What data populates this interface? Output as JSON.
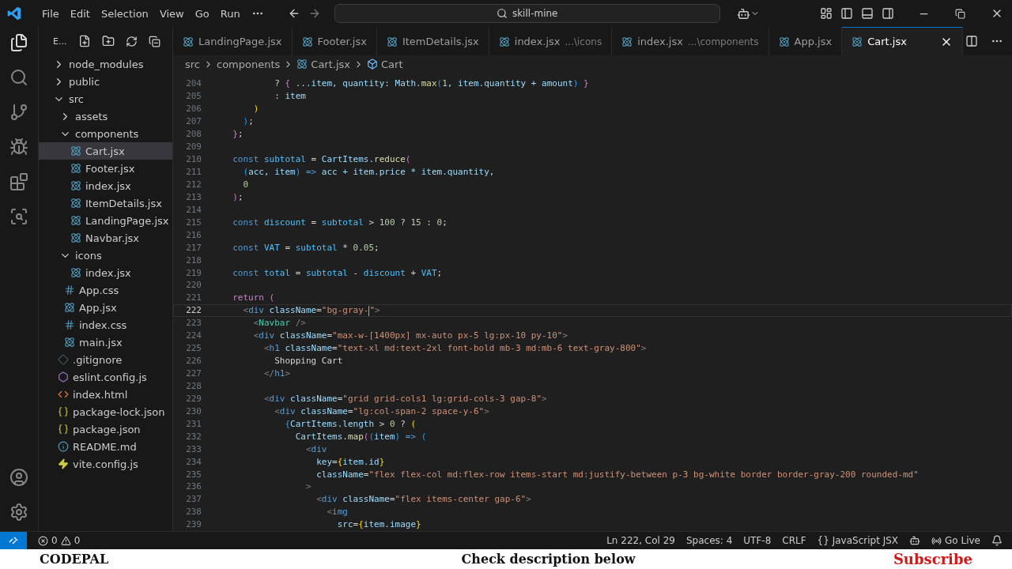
{
  "menu": [
    "File",
    "Edit",
    "Selection",
    "View",
    "Go",
    "Run"
  ],
  "search": {
    "value": "skill-mine"
  },
  "explorer": {
    "title": "E..."
  },
  "tree": [
    {
      "label": "node_modules",
      "kind": "folder",
      "expanded": false,
      "selected": false
    },
    {
      "label": "public",
      "kind": "folder",
      "expanded": false,
      "selected": false
    },
    {
      "label": "src",
      "kind": "folder",
      "expanded": true,
      "selected": false,
      "children": [
        {
          "label": "assets",
          "kind": "folder",
          "expanded": false,
          "selected": false
        },
        {
          "label": "components",
          "kind": "folder",
          "expanded": true,
          "selected": false,
          "children": [
            {
              "label": "Cart.jsx",
              "kind": "react",
              "selected": true
            },
            {
              "label": "Footer.jsx",
              "kind": "react",
              "selected": false
            },
            {
              "label": "index.jsx",
              "kind": "react",
              "selected": false
            },
            {
              "label": "ItemDetails.jsx",
              "kind": "react",
              "selected": false
            },
            {
              "label": "LandingPage.jsx",
              "kind": "react",
              "selected": false
            },
            {
              "label": "Navbar.jsx",
              "kind": "react",
              "selected": false
            }
          ]
        },
        {
          "label": "icons",
          "kind": "folder",
          "expanded": true,
          "selected": false,
          "children": [
            {
              "label": "index.jsx",
              "kind": "react",
              "selected": false
            }
          ]
        },
        {
          "label": "App.css",
          "kind": "css",
          "selected": false
        },
        {
          "label": "App.jsx",
          "kind": "react",
          "selected": false
        },
        {
          "label": "index.css",
          "kind": "css",
          "selected": false
        },
        {
          "label": "main.jsx",
          "kind": "react",
          "selected": false
        }
      ]
    },
    {
      "label": ".gitignore",
      "kind": "git",
      "selected": false
    },
    {
      "label": "eslint.config.js",
      "kind": "eslint",
      "selected": false
    },
    {
      "label": "index.html",
      "kind": "html",
      "selected": false
    },
    {
      "label": "package-lock.json",
      "kind": "json",
      "selected": false
    },
    {
      "label": "package.json",
      "kind": "json",
      "selected": false
    },
    {
      "label": "README.md",
      "kind": "info",
      "selected": false
    },
    {
      "label": "vite.config.js",
      "kind": "vite",
      "selected": false
    }
  ],
  "tabs": [
    {
      "label": "LandingPage.jsx",
      "selected": false
    },
    {
      "label": "Footer.jsx",
      "selected": false
    },
    {
      "label": "ItemDetails.jsx",
      "selected": false
    },
    {
      "label": "index.jsx",
      "description": "...\\icons",
      "selected": false
    },
    {
      "label": "index.jsx",
      "description": "...\\components",
      "selected": false
    },
    {
      "label": "App.jsx",
      "selected": false
    },
    {
      "label": "Cart.jsx",
      "selected": true
    }
  ],
  "breadcrumb": [
    {
      "label": "src",
      "kind": "folder"
    },
    {
      "label": "components",
      "kind": "folder"
    },
    {
      "label": "Cart.jsx",
      "kind": "react"
    },
    {
      "label": "Cart",
      "kind": "symbol"
    }
  ],
  "lines": [
    {
      "number": "204",
      "current": false,
      "tokens": [
        {
          "text": "          ? ",
          "kind": "op"
        },
        {
          "text": "{",
          "kind": "p2"
        },
        {
          "text": " ...item, quantity: ",
          "kind": "var"
        },
        {
          "text": "Math",
          "kind": "var"
        },
        {
          "text": ".",
          "kind": "op"
        },
        {
          "text": "max",
          "kind": "fn"
        },
        {
          "text": "(",
          "kind": "p3"
        },
        {
          "text": "1",
          "kind": "num"
        },
        {
          "text": ", item.quantity + amount",
          "kind": "var"
        },
        {
          "text": ")",
          "kind": "p3"
        },
        {
          "text": " }",
          "kind": "p2"
        }
      ]
    },
    {
      "number": "205",
      "current": false,
      "tokens": [
        {
          "text": "          : ",
          "kind": "op"
        },
        {
          "text": "item",
          "kind": "var"
        }
      ]
    },
    {
      "number": "206",
      "current": false,
      "tokens": [
        {
          "text": "      )",
          "kind": "p1"
        }
      ]
    },
    {
      "number": "207",
      "current": false,
      "tokens": [
        {
          "text": "    )",
          "kind": "p3"
        },
        {
          "text": ";",
          "kind": "op"
        }
      ]
    },
    {
      "number": "208",
      "current": false,
      "tokens": [
        {
          "text": "  }",
          "kind": "p2"
        },
        {
          "text": ";",
          "kind": "op"
        }
      ]
    },
    {
      "number": "209",
      "current": false
    },
    {
      "number": "210",
      "current": false,
      "tokens": [
        {
          "text": "  const ",
          "kind": "kw"
        },
        {
          "text": "subtotal",
          "kind": "cvar"
        },
        {
          "text": " = ",
          "kind": "op"
        },
        {
          "text": "CartItems",
          "kind": "var"
        },
        {
          "text": ".",
          "kind": "op"
        },
        {
          "text": "reduce",
          "kind": "fn"
        },
        {
          "text": "(",
          "kind": "p2"
        }
      ]
    },
    {
      "number": "211",
      "current": false,
      "tokens": [
        {
          "text": "    (",
          "kind": "p3"
        },
        {
          "text": "acc, item",
          "kind": "var"
        },
        {
          "text": ")",
          "kind": "p3"
        },
        {
          "text": " => ",
          "kind": "kw"
        },
        {
          "text": "acc + item.price * item.quantity,",
          "kind": "var"
        }
      ]
    },
    {
      "number": "212",
      "current": false,
      "tokens": [
        {
          "text": "    0",
          "kind": "num"
        }
      ]
    },
    {
      "number": "213",
      "current": false,
      "tokens": [
        {
          "text": "  )",
          "kind": "p2"
        },
        {
          "text": ";",
          "kind": "op"
        }
      ]
    },
    {
      "number": "214",
      "current": false
    },
    {
      "number": "215",
      "current": false,
      "tokens": [
        {
          "text": "  const ",
          "kind": "kw"
        },
        {
          "text": "discount",
          "kind": "cvar"
        },
        {
          "text": " = ",
          "kind": "op"
        },
        {
          "text": "subtotal",
          "kind": "cvar"
        },
        {
          "text": " > ",
          "kind": "op"
        },
        {
          "text": "100",
          "kind": "num"
        },
        {
          "text": " ? ",
          "kind": "op"
        },
        {
          "text": "15",
          "kind": "num"
        },
        {
          "text": " : ",
          "kind": "op"
        },
        {
          "text": "0",
          "kind": "num"
        },
        {
          "text": ";",
          "kind": "op"
        }
      ]
    },
    {
      "number": "216",
      "current": false
    },
    {
      "number": "217",
      "current": false,
      "tokens": [
        {
          "text": "  const ",
          "kind": "kw"
        },
        {
          "text": "VAT",
          "kind": "cvar"
        },
        {
          "text": " = ",
          "kind": "op"
        },
        {
          "text": "subtotal",
          "kind": "cvar"
        },
        {
          "text": " * ",
          "kind": "op"
        },
        {
          "text": "0.05",
          "kind": "num"
        },
        {
          "text": ";",
          "kind": "op"
        }
      ]
    },
    {
      "number": "218",
      "current": false
    },
    {
      "number": "219",
      "current": false,
      "tokens": [
        {
          "text": "  const ",
          "kind": "kw"
        },
        {
          "text": "total",
          "kind": "cvar"
        },
        {
          "text": " = ",
          "kind": "op"
        },
        {
          "text": "subtotal",
          "kind": "cvar"
        },
        {
          "text": " - ",
          "kind": "op"
        },
        {
          "text": "discount",
          "kind": "cvar"
        },
        {
          "text": " + ",
          "kind": "op"
        },
        {
          "text": "VAT",
          "kind": "cvar"
        },
        {
          "text": ";",
          "kind": "op"
        }
      ]
    },
    {
      "number": "220",
      "current": false
    },
    {
      "number": "221",
      "current": false,
      "tokens": [
        {
          "text": "  return ",
          "kind": "ctl"
        },
        {
          "text": "(",
          "kind": "p2"
        }
      ]
    },
    {
      "number": "222",
      "current": true,
      "tokens": [
        {
          "text": "    <",
          "kind": "ang"
        },
        {
          "text": "div",
          "kind": "tag"
        },
        {
          "text": " className",
          "kind": "attr"
        },
        {
          "text": "=",
          "kind": "op"
        },
        {
          "text": "\"bg-gray-\"",
          "kind": "str"
        },
        {
          "text": ">",
          "kind": "ang"
        }
      ]
    },
    {
      "number": "223",
      "current": false,
      "tokens": [
        {
          "text": "      <",
          "kind": "ang"
        },
        {
          "text": "Navbar",
          "kind": "comp"
        },
        {
          "text": " />",
          "kind": "ang"
        }
      ]
    },
    {
      "number": "224",
      "current": false,
      "tokens": [
        {
          "text": "      <",
          "kind": "ang"
        },
        {
          "text": "div",
          "kind": "tag"
        },
        {
          "text": " className",
          "kind": "attr"
        },
        {
          "text": "=",
          "kind": "op"
        },
        {
          "text": "\"max-w-[1400px] mx-auto px-5 lg:px-10 py-10\"",
          "kind": "str"
        },
        {
          "text": ">",
          "kind": "ang"
        }
      ]
    },
    {
      "number": "225",
      "current": false,
      "tokens": [
        {
          "text": "        <",
          "kind": "ang"
        },
        {
          "text": "h1",
          "kind": "tag"
        },
        {
          "text": " className",
          "kind": "attr"
        },
        {
          "text": "=",
          "kind": "op"
        },
        {
          "text": "\"text-xl md:text-2xl font-bold mb-3 md:mb-6 text-gray-800\"",
          "kind": "str"
        },
        {
          "text": ">",
          "kind": "ang"
        }
      ]
    },
    {
      "number": "226",
      "current": false,
      "tokens": [
        {
          "text": "          Shopping Cart",
          "kind": "op"
        }
      ]
    },
    {
      "number": "227",
      "current": false,
      "tokens": [
        {
          "text": "        </",
          "kind": "ang"
        },
        {
          "text": "h1",
          "kind": "tag"
        },
        {
          "text": ">",
          "kind": "ang"
        }
      ]
    },
    {
      "number": "228",
      "current": false
    },
    {
      "number": "229",
      "current": false,
      "tokens": [
        {
          "text": "        <",
          "kind": "ang"
        },
        {
          "text": "div",
          "kind": "tag"
        },
        {
          "text": " className",
          "kind": "attr"
        },
        {
          "text": "=",
          "kind": "op"
        },
        {
          "text": "\"grid grid-cols1 lg:grid-cols-3 gap-8\"",
          "kind": "str"
        },
        {
          "text": ">",
          "kind": "ang"
        }
      ]
    },
    {
      "number": "230",
      "current": false,
      "tokens": [
        {
          "text": "          <",
          "kind": "ang"
        },
        {
          "text": "div",
          "kind": "tag"
        },
        {
          "text": " className",
          "kind": "attr"
        },
        {
          "text": "=",
          "kind": "op"
        },
        {
          "text": "\"lg:col-span-2 space-y-6\"",
          "kind": "str"
        },
        {
          "text": ">",
          "kind": "ang"
        }
      ]
    },
    {
      "number": "231",
      "current": false,
      "tokens": [
        {
          "text": "            {",
          "kind": "p3"
        },
        {
          "text": "CartItems",
          "kind": "var"
        },
        {
          "text": ".",
          "kind": "op"
        },
        {
          "text": "length",
          "kind": "var"
        },
        {
          "text": " > ",
          "kind": "op"
        },
        {
          "text": "0",
          "kind": "num"
        },
        {
          "text": " ? ",
          "kind": "op"
        },
        {
          "text": "(",
          "kind": "p1"
        }
      ]
    },
    {
      "number": "232",
      "current": false,
      "tokens": [
        {
          "text": "              CartItems",
          "kind": "var"
        },
        {
          "text": ".",
          "kind": "op"
        },
        {
          "text": "map",
          "kind": "fn"
        },
        {
          "text": "(",
          "kind": "p2"
        },
        {
          "text": "(",
          "kind": "p3"
        },
        {
          "text": "item",
          "kind": "var"
        },
        {
          "text": ")",
          "kind": "p3"
        },
        {
          "text": " => ",
          "kind": "kw"
        },
        {
          "text": "(",
          "kind": "p3"
        }
      ]
    },
    {
      "number": "233",
      "current": false,
      "tokens": [
        {
          "text": "                <",
          "kind": "ang"
        },
        {
          "text": "div",
          "kind": "tag"
        }
      ]
    },
    {
      "number": "234",
      "current": false,
      "tokens": [
        {
          "text": "                  key",
          "kind": "attr"
        },
        {
          "text": "=",
          "kind": "op"
        },
        {
          "text": "{",
          "kind": "p1"
        },
        {
          "text": "item.id",
          "kind": "var"
        },
        {
          "text": "}",
          "kind": "p1"
        }
      ]
    },
    {
      "number": "235",
      "current": false,
      "tokens": [
        {
          "text": "                  className",
          "kind": "attr"
        },
        {
          "text": "=",
          "kind": "op"
        },
        {
          "text": "\"flex flex-col md:flex-row items-start md:justify-between p-3 bg-white border border-gray-200 rounded-md\"",
          "kind": "str"
        }
      ]
    },
    {
      "number": "236",
      "current": false,
      "tokens": [
        {
          "text": "                >",
          "kind": "ang"
        }
      ]
    },
    {
      "number": "237",
      "current": false,
      "tokens": [
        {
          "text": "                  <",
          "kind": "ang"
        },
        {
          "text": "div",
          "kind": "tag"
        },
        {
          "text": " className",
          "kind": "attr"
        },
        {
          "text": "=",
          "kind": "op"
        },
        {
          "text": "\"flex items-center gap-6\"",
          "kind": "str"
        },
        {
          "text": ">",
          "kind": "ang"
        }
      ]
    },
    {
      "number": "238",
      "current": false,
      "tokens": [
        {
          "text": "                    <",
          "kind": "ang"
        },
        {
          "text": "img",
          "kind": "tag"
        }
      ]
    },
    {
      "number": "239",
      "current": false,
      "tokens": [
        {
          "text": "                      src",
          "kind": "attr"
        },
        {
          "text": "=",
          "kind": "op"
        },
        {
          "text": "{",
          "kind": "p1"
        },
        {
          "text": "item.image",
          "kind": "var"
        },
        {
          "text": "}",
          "kind": "p1"
        }
      ]
    }
  ],
  "status": {
    "errors": "0",
    "warnings": "0",
    "items": [
      "Ln 222, Col 29",
      "Spaces: 4",
      "UTF-8",
      "CRLF"
    ],
    "braces": "{}",
    "language": "JavaScript JSX",
    "live": "Go Live"
  },
  "banner": {
    "left": "CODEPAL",
    "center": "Check description below",
    "right": "Subscribe"
  }
}
